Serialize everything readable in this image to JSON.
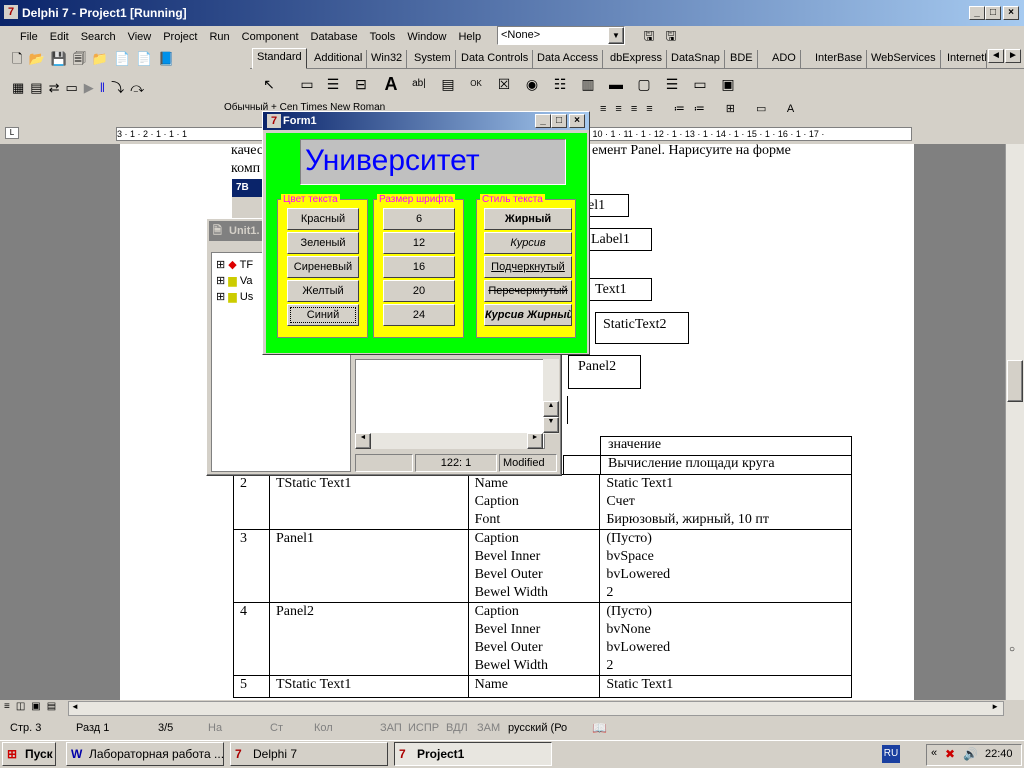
{
  "window": {
    "title": "Delphi 7 - Project1 [Running]"
  },
  "menu": [
    "File",
    "Edit",
    "Search",
    "View",
    "Project",
    "Run",
    "Component",
    "Database",
    "Tools",
    "Window",
    "Help"
  ],
  "component_select": {
    "value": "<None>"
  },
  "palette_tabs": [
    "Standard",
    "Additional",
    "Win32",
    "System",
    "Data Controls",
    "Data Access",
    "dbExpress",
    "DataSnap",
    "BDE",
    "ADO",
    "InterBase",
    "WebServices",
    "InternetEx"
  ],
  "ruler": {
    "left": "3 · 1 · 2 · 1 · 1 · 1",
    "right": "· 10 · 1 · 11 · 1 · 12 · 1 · 13 · 1 · 14 · 1 · 15 · 1 · 16 · 1 · 17 ·"
  },
  "doc": {
    "format_text": "Обычный + Cen  Times New Roman",
    "line1_left": "качес",
    "line1_right": "емент   Panel.  Нарисуите  на  форме",
    "line2_left": "комп",
    "labels": [
      "el1",
      "Label1",
      "Text1",
      "StaticText2",
      "Panel2"
    ],
    "table_header": [
      "",
      "",
      "",
      "значение"
    ],
    "table_row1": "Вычисление площади круга",
    "rows": [
      {
        "num": "2",
        "comp": "TStatic Text1",
        "props": [
          "Name",
          "Caption",
          "Font"
        ],
        "vals": [
          "Static Text1",
          "Счет",
          "Бирюзовый, жирный, 10 пт"
        ]
      },
      {
        "num": "3",
        "comp": "Panel1",
        "props": [
          "Caption",
          "Bevel Inner",
          "Bevel Outer",
          "Bewel Width"
        ],
        "vals": [
          "(Пусто)",
          "bvSpace",
          "bvLowered",
          "2"
        ]
      },
      {
        "num": "4",
        "comp": "Panel2",
        "props": [
          "Caption",
          "Bevel Inner",
          "Bevel Outer",
          "Bewel Width"
        ],
        "vals": [
          "(Пусто)",
          "bvNone",
          "bvLowered",
          "2"
        ]
      },
      {
        "num": "5",
        "comp": "TStatic Text1",
        "props": [
          "Name"
        ],
        "vals": [
          "Static Text1"
        ]
      }
    ]
  },
  "unit_window": {
    "title": "Unit1.",
    "tree": [
      "TF",
      "Va",
      "Us"
    ],
    "status_pos": "122:   1",
    "status_mod": "Modified"
  },
  "form1": {
    "title": "Form1",
    "panel_caption": "Университет",
    "groups": [
      {
        "caption": "Цвет текста",
        "buttons": [
          "Красный",
          "Зеленый",
          "Сиреневый",
          "Желтый",
          "Синий"
        ]
      },
      {
        "caption": "Размер шрифта",
        "buttons": [
          "6",
          "12",
          "16",
          "20",
          "24"
        ]
      },
      {
        "caption": "Стиль текста",
        "buttons": [
          "Жирный",
          "Курсив",
          "Подчеркнутый",
          "Перечеркнутый",
          "Курсив Жирный"
        ]
      }
    ],
    "colors": {
      "bg": "#00ff00",
      "group": "#ffff00",
      "caption": "#ff00ff",
      "panel_text": "#0000ff"
    }
  },
  "word_status": {
    "page": "Стр.  3",
    "section": "Разд  1",
    "pages": "3/5",
    "at": "На",
    "line": "Ст",
    "col": "Кол",
    "rec": "ЗАП",
    "trk": "ИСПР",
    "ext": "ВДЛ",
    "ovr": "ЗАМ",
    "lang": "русский (Ро"
  },
  "taskbar": {
    "start": "Пуск",
    "items": [
      "Лабораторная работа ...",
      "Delphi 7",
      "Project1"
    ],
    "lang": "RU",
    "time": "22:40"
  }
}
